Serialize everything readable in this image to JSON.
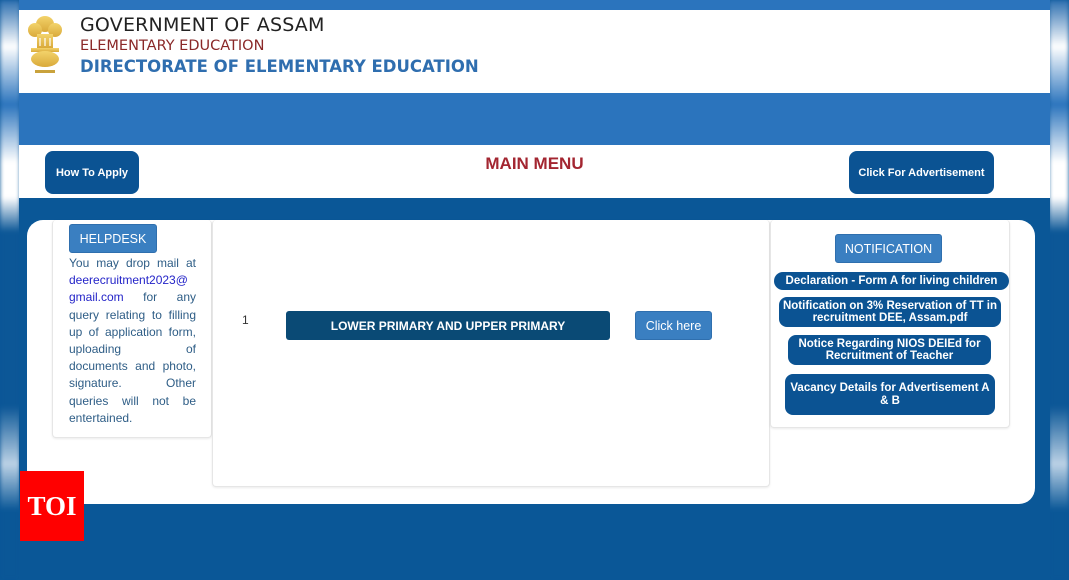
{
  "header": {
    "logo_icon": "state-emblem-icon",
    "line1": "GOVERNMENT OF ASSAM",
    "line2": "ELEMENTARY EDUCATION",
    "line3": "DIRECTORATE OF ELEMENTARY EDUCATION"
  },
  "menu_bar": {
    "how_to_apply": "How To Apply",
    "title": "MAIN MENU",
    "advertisement": "Click For Advertisement"
  },
  "helpdesk": {
    "button": "HELPDESK",
    "text_before": "You may drop mail at ",
    "email": "deerecruitment2023@gmail.com",
    "email_line1": "deerecruitment2023@",
    "email_line2": "gmail.com",
    "text_after": " for any query relating to filling up of application form, uploading of documents and photo, signature. Other queries will not be entertained."
  },
  "posts": [
    {
      "number": "1",
      "label": "LOWER PRIMARY AND UPPER PRIMARY",
      "action": "Click here"
    }
  ],
  "notifications": {
    "button": "NOTIFICATION",
    "links": [
      "Declaration - Form A for living children",
      "Notification on 3% Reservation of TT in recruitment DEE, Assam.pdf",
      "Notice Regarding NIOS DEIEd for Recruitment of Teacher",
      "Vacancy Details for Advertisement A & B"
    ]
  },
  "watermark": {
    "text": "TOI"
  },
  "colors": {
    "primary_dark": "#0b5393",
    "primary_light": "#2b74bd",
    "title_red": "#a32631",
    "toi_red": "#ff0000"
  }
}
